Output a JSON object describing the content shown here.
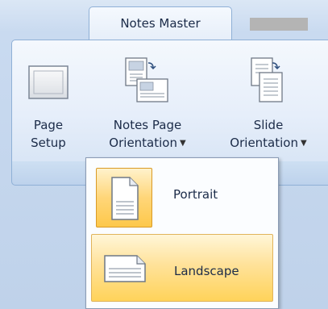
{
  "tabs": {
    "active_label": "Notes Master",
    "inactive_label": ""
  },
  "ribbon": {
    "page_setup": {
      "line1": "Page",
      "line2": "Setup",
      "icon": "page-setup-icon"
    },
    "notes_page_orientation": {
      "line1": "Notes Page",
      "line2": "Orientation",
      "icon": "notes-page-orientation-icon",
      "has_dropdown": true
    },
    "slide_orientation": {
      "line1": "Slide",
      "line2": "Orientation",
      "icon": "slide-orientation-icon",
      "has_dropdown": true
    }
  },
  "dropdown": {
    "items": [
      {
        "label": "Portrait",
        "icon": "portrait-page-icon",
        "selected": true
      },
      {
        "label": "Landscape",
        "icon": "landscape-page-icon",
        "hovered": true
      }
    ]
  },
  "colors": {
    "ribbon_border": "#8fb0d6",
    "highlight": "#ffd679",
    "text": "#1b2b48"
  }
}
